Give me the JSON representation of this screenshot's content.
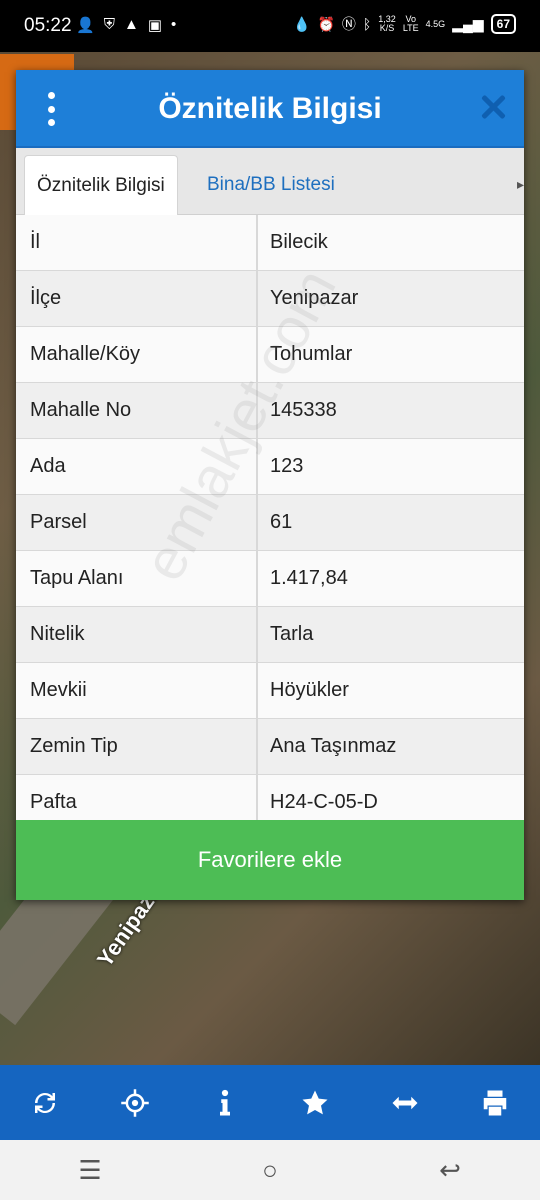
{
  "status_bar": {
    "time": "05:22",
    "net_speed": "1,32",
    "net_unit": "K/S",
    "vo": "Vo",
    "lte": "LTE",
    "network": "4.5G",
    "battery": "67"
  },
  "map": {
    "road_label": "Yenipazar Yolu"
  },
  "dialog": {
    "title": "Öznitelik Bilgisi",
    "tabs": [
      {
        "label": "Öznitelik Bilgisi"
      },
      {
        "label": "Bina/BB Listesi"
      }
    ],
    "rows": [
      {
        "label": "İl",
        "value": "Bilecik"
      },
      {
        "label": "İlçe",
        "value": "Yenipazar"
      },
      {
        "label": "Mahalle/Köy",
        "value": "Tohumlar"
      },
      {
        "label": "Mahalle No",
        "value": "145338"
      },
      {
        "label": "Ada",
        "value": "123"
      },
      {
        "label": "Parsel",
        "value": "61"
      },
      {
        "label": "Tapu Alanı",
        "value": "1.417,84"
      },
      {
        "label": "Nitelik",
        "value": "Tarla"
      },
      {
        "label": "Mevkii",
        "value": "Höyükler"
      },
      {
        "label": "Zemin Tip",
        "value": "Ana Taşınmaz"
      },
      {
        "label": "Pafta",
        "value": "H24-C-05-D"
      }
    ],
    "favorite_button": "Favorilere ekle"
  },
  "watermark": "emlakjet.com",
  "toolbar": {
    "icons": [
      "refresh-icon",
      "locate-icon",
      "info-icon",
      "star-icon",
      "measure-icon",
      "print-icon"
    ]
  },
  "colors": {
    "header_blue": "#1e7fd8",
    "toolbar_blue": "#1565c0",
    "favorite_green": "#4dbd55",
    "tab_link": "#1e6fbf"
  }
}
